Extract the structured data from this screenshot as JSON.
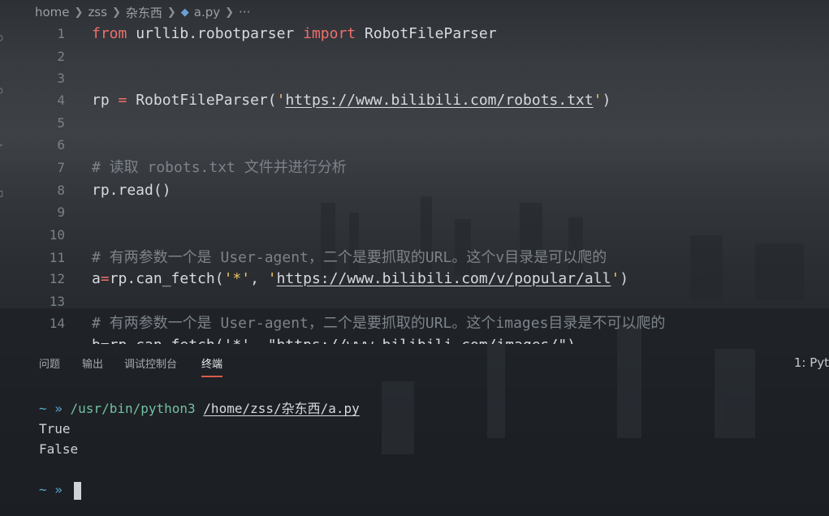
{
  "breadcrumb": {
    "items": [
      "home",
      "zss",
      "杂东西",
      "a.py",
      "···"
    ]
  },
  "editor": {
    "lines": [
      {
        "n": "1"
      },
      {
        "n": "2"
      },
      {
        "n": "3"
      },
      {
        "n": "4"
      },
      {
        "n": "5"
      },
      {
        "n": "6"
      },
      {
        "n": "7"
      },
      {
        "n": "8"
      },
      {
        "n": "9"
      },
      {
        "n": "10"
      },
      {
        "n": "11"
      },
      {
        "n": "12"
      },
      {
        "n": "13"
      },
      {
        "n": "14"
      }
    ],
    "tokens": {
      "l1_from": "from",
      "l1_mod": " urllib.robotparser ",
      "l1_import": "import",
      "l1_cls": " RobotFileParser",
      "l4_a": "rp ",
      "l4_eq": "=",
      "l4_b": " RobotFileParser(",
      "l4_q1": "'",
      "l4_url": "https://www.bilibili.com/robots.txt",
      "l4_q2": "'",
      "l4_c": ")",
      "l7_cmt": "# 读取 robots.txt 文件并进行分析",
      "l8": "rp.read()",
      "l11_cmt": "# 有两参数一个是 User-agent，二个是要抓取的URL。这个v目录是可以爬的",
      "l12_a": "a",
      "l12_eq": "=",
      "l12_b": "rp.can_fetch(",
      "l12_s1": "'*'",
      "l12_c": ", ",
      "l12_q1": "'",
      "l12_url": "https://www.bilibili.com/v/popular/all",
      "l12_q2": "'",
      "l12_d": ")",
      "l14_cmt": "# 有两参数一个是 User-agent，二个是要抓取的URL。这个images目录是不可以爬的",
      "l15_partial": "b=rp.can_fetch('*', \"https://www.bilibili.com/images/\")"
    }
  },
  "panel": {
    "tabs": [
      "问题",
      "输出",
      "调试控制台",
      "终端"
    ],
    "active_tab": "终端",
    "terminal_select": "1: Pyt"
  },
  "terminal": {
    "prompt": "~ » ",
    "command": "/usr/bin/python3",
    "arg": "/home/zss/杂东西/a.py",
    "out1": "True",
    "out2": "False",
    "prompt2": "~ » "
  },
  "colors": {
    "keyword": "#ef6f6c",
    "string": "#e9c46a",
    "comment": "#7d838a",
    "prompt": "#5aa7d6",
    "active_tab_underline": "#d85a4a"
  }
}
